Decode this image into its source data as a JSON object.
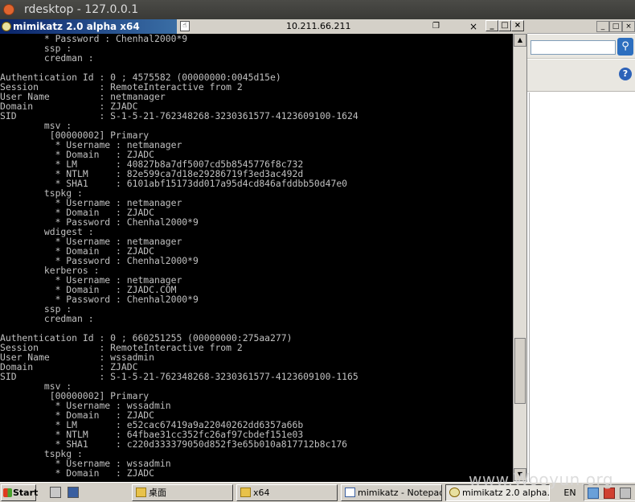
{
  "outer_window": {
    "title": "rdesktop - 127.0.0.1"
  },
  "console": {
    "title": "mimikatz 2.0 alpha x64",
    "remote_ip": "10.211.66.211",
    "lines": [
      "        * Password : Chenhal2000*9",
      "        ssp :",
      "        credman :",
      "",
      "Authentication Id : 0 ; 4575582 (00000000:0045d15e)",
      "Session           : RemoteInteractive from 2",
      "User Name         : netmanager",
      "Domain            : ZJADC",
      "SID               : S-1-5-21-762348268-3230361577-4123609100-1624",
      "        msv :",
      "         [00000002] Primary",
      "          * Username : netmanager",
      "          * Domain   : ZJADC",
      "          * LM       : 40827b8a7df5007cd5b8545776f8c732",
      "          * NTLM     : 82e599ca7d18e29286719f3ed3ac492d",
      "          * SHA1     : 6101abf15173dd017a95d4cd846afddbb50d47e0",
      "        tspkg :",
      "          * Username : netmanager",
      "          * Domain   : ZJADC",
      "          * Password : Chenhal2000*9",
      "        wdigest :",
      "          * Username : netmanager",
      "          * Domain   : ZJADC",
      "          * Password : Chenhal2000*9",
      "        kerberos :",
      "          * Username : netmanager",
      "          * Domain   : ZJADC.COM",
      "          * Password : Chenhal2000*9",
      "        ssp :",
      "        credman :",
      "",
      "Authentication Id : 0 ; 660251255 (00000000:275aa277)",
      "Session           : RemoteInteractive from 2",
      "User Name         : wssadmin",
      "Domain            : ZJADC",
      "SID               : S-1-5-21-762348268-3230361577-4123609100-1165",
      "        msv :",
      "         [00000002] Primary",
      "          * Username : wssadmin",
      "          * Domain   : ZJADC",
      "          * LM       : e52cac67419a9a22040262dd6357a66b",
      "          * NTLM     : 64fbae31cc352fc26af97cbdef151e03",
      "          * SHA1     : c220d333379050d852f3e65b010a817712b8c176",
      "        tspkg :",
      "          * Username : wssadmin",
      "          * Domain   : ZJADC"
    ]
  },
  "taskbar": {
    "start_label": "Start",
    "items": [
      {
        "label": "桌面",
        "icon": "folder-icon"
      },
      {
        "label": "x64",
        "icon": "folder-icon"
      },
      {
        "label": "mimikatz - Notepad",
        "icon": "notepad-icon"
      },
      {
        "label": "mimikatz 2.0 alpha...",
        "icon": "mimikatz-icon"
      }
    ],
    "language": "EN"
  },
  "watermark": "www.Wooyun.org"
}
